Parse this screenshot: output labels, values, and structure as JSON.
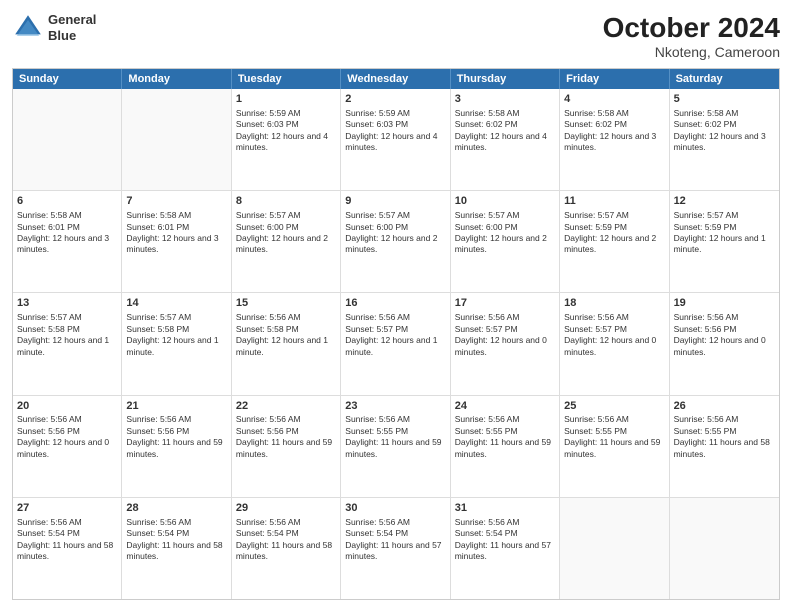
{
  "header": {
    "logo_line1": "General",
    "logo_line2": "Blue",
    "month_title": "October 2024",
    "location": "Nkoteng, Cameroon"
  },
  "weekdays": [
    "Sunday",
    "Monday",
    "Tuesday",
    "Wednesday",
    "Thursday",
    "Friday",
    "Saturday"
  ],
  "rows": [
    [
      {
        "day": "",
        "info": "",
        "empty": true
      },
      {
        "day": "",
        "info": "",
        "empty": true
      },
      {
        "day": "1",
        "info": "Sunrise: 5:59 AM\nSunset: 6:03 PM\nDaylight: 12 hours and 4 minutes."
      },
      {
        "day": "2",
        "info": "Sunrise: 5:59 AM\nSunset: 6:03 PM\nDaylight: 12 hours and 4 minutes."
      },
      {
        "day": "3",
        "info": "Sunrise: 5:58 AM\nSunset: 6:02 PM\nDaylight: 12 hours and 4 minutes."
      },
      {
        "day": "4",
        "info": "Sunrise: 5:58 AM\nSunset: 6:02 PM\nDaylight: 12 hours and 3 minutes."
      },
      {
        "day": "5",
        "info": "Sunrise: 5:58 AM\nSunset: 6:02 PM\nDaylight: 12 hours and 3 minutes."
      }
    ],
    [
      {
        "day": "6",
        "info": "Sunrise: 5:58 AM\nSunset: 6:01 PM\nDaylight: 12 hours and 3 minutes."
      },
      {
        "day": "7",
        "info": "Sunrise: 5:58 AM\nSunset: 6:01 PM\nDaylight: 12 hours and 3 minutes."
      },
      {
        "day": "8",
        "info": "Sunrise: 5:57 AM\nSunset: 6:00 PM\nDaylight: 12 hours and 2 minutes."
      },
      {
        "day": "9",
        "info": "Sunrise: 5:57 AM\nSunset: 6:00 PM\nDaylight: 12 hours and 2 minutes."
      },
      {
        "day": "10",
        "info": "Sunrise: 5:57 AM\nSunset: 6:00 PM\nDaylight: 12 hours and 2 minutes."
      },
      {
        "day": "11",
        "info": "Sunrise: 5:57 AM\nSunset: 5:59 PM\nDaylight: 12 hours and 2 minutes."
      },
      {
        "day": "12",
        "info": "Sunrise: 5:57 AM\nSunset: 5:59 PM\nDaylight: 12 hours and 1 minute."
      }
    ],
    [
      {
        "day": "13",
        "info": "Sunrise: 5:57 AM\nSunset: 5:58 PM\nDaylight: 12 hours and 1 minute."
      },
      {
        "day": "14",
        "info": "Sunrise: 5:57 AM\nSunset: 5:58 PM\nDaylight: 12 hours and 1 minute."
      },
      {
        "day": "15",
        "info": "Sunrise: 5:56 AM\nSunset: 5:58 PM\nDaylight: 12 hours and 1 minute."
      },
      {
        "day": "16",
        "info": "Sunrise: 5:56 AM\nSunset: 5:57 PM\nDaylight: 12 hours and 1 minute."
      },
      {
        "day": "17",
        "info": "Sunrise: 5:56 AM\nSunset: 5:57 PM\nDaylight: 12 hours and 0 minutes."
      },
      {
        "day": "18",
        "info": "Sunrise: 5:56 AM\nSunset: 5:57 PM\nDaylight: 12 hours and 0 minutes."
      },
      {
        "day": "19",
        "info": "Sunrise: 5:56 AM\nSunset: 5:56 PM\nDaylight: 12 hours and 0 minutes."
      }
    ],
    [
      {
        "day": "20",
        "info": "Sunrise: 5:56 AM\nSunset: 5:56 PM\nDaylight: 12 hours and 0 minutes."
      },
      {
        "day": "21",
        "info": "Sunrise: 5:56 AM\nSunset: 5:56 PM\nDaylight: 11 hours and 59 minutes."
      },
      {
        "day": "22",
        "info": "Sunrise: 5:56 AM\nSunset: 5:56 PM\nDaylight: 11 hours and 59 minutes."
      },
      {
        "day": "23",
        "info": "Sunrise: 5:56 AM\nSunset: 5:55 PM\nDaylight: 11 hours and 59 minutes."
      },
      {
        "day": "24",
        "info": "Sunrise: 5:56 AM\nSunset: 5:55 PM\nDaylight: 11 hours and 59 minutes."
      },
      {
        "day": "25",
        "info": "Sunrise: 5:56 AM\nSunset: 5:55 PM\nDaylight: 11 hours and 59 minutes."
      },
      {
        "day": "26",
        "info": "Sunrise: 5:56 AM\nSunset: 5:55 PM\nDaylight: 11 hours and 58 minutes."
      }
    ],
    [
      {
        "day": "27",
        "info": "Sunrise: 5:56 AM\nSunset: 5:54 PM\nDaylight: 11 hours and 58 minutes."
      },
      {
        "day": "28",
        "info": "Sunrise: 5:56 AM\nSunset: 5:54 PM\nDaylight: 11 hours and 58 minutes."
      },
      {
        "day": "29",
        "info": "Sunrise: 5:56 AM\nSunset: 5:54 PM\nDaylight: 11 hours and 58 minutes."
      },
      {
        "day": "30",
        "info": "Sunrise: 5:56 AM\nSunset: 5:54 PM\nDaylight: 11 hours and 57 minutes."
      },
      {
        "day": "31",
        "info": "Sunrise: 5:56 AM\nSunset: 5:54 PM\nDaylight: 11 hours and 57 minutes."
      },
      {
        "day": "",
        "info": "",
        "empty": true
      },
      {
        "day": "",
        "info": "",
        "empty": true
      }
    ]
  ]
}
